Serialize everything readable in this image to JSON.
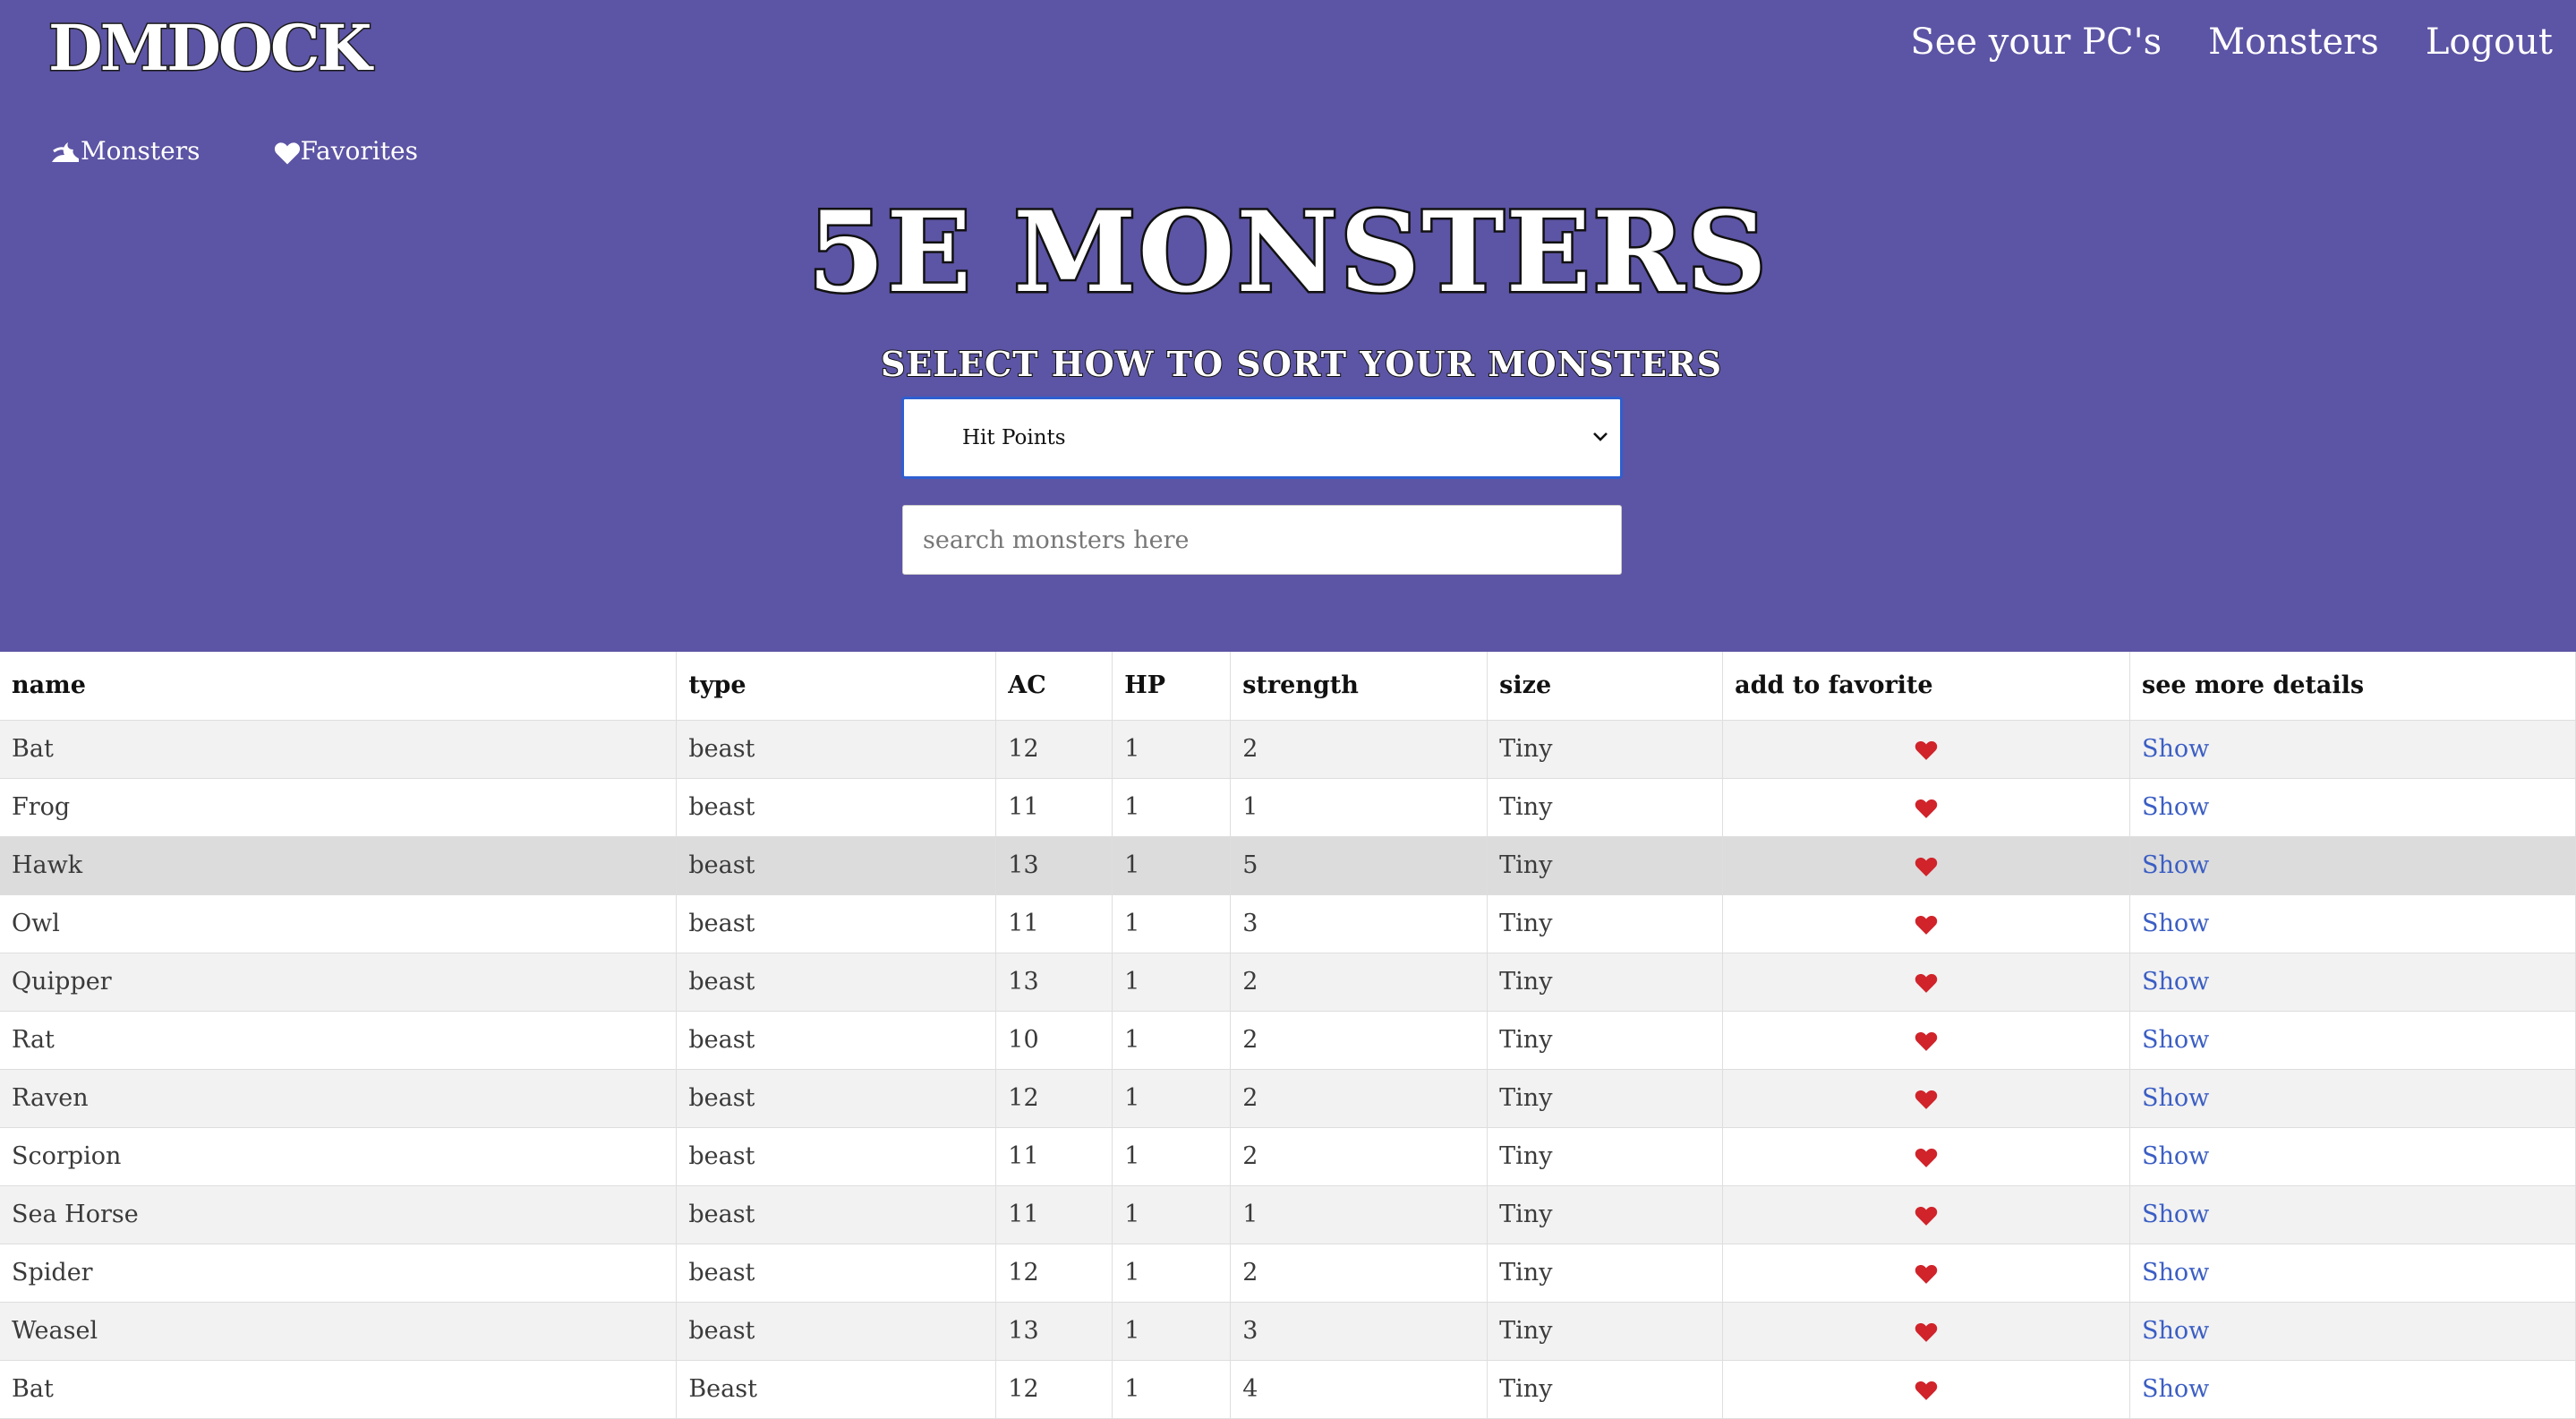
{
  "brand": {
    "logo_text": "DMDOCK"
  },
  "topnav": {
    "items": [
      "See your PC's",
      "Monsters",
      "Logout"
    ]
  },
  "subnav": {
    "monsters_label": "Monsters",
    "favorites_label": "Favorites"
  },
  "page": {
    "title": "5E MONSTERS",
    "sort_label": "SELECT HOW TO SORT YOUR MONSTERS",
    "sort_selected": "Hit Points",
    "search_placeholder": "search monsters here"
  },
  "table": {
    "headers": [
      "name",
      "type",
      "AC",
      "HP",
      "strength",
      "size",
      "add to favorite",
      "see more details"
    ],
    "rows": [
      {
        "name": "Bat",
        "type": "beast",
        "ac": "12",
        "hp": "1",
        "strength": "2",
        "size": "Tiny",
        "details": "Show"
      },
      {
        "name": "Frog",
        "type": "beast",
        "ac": "11",
        "hp": "1",
        "strength": "1",
        "size": "Tiny",
        "details": "Show"
      },
      {
        "name": "Hawk",
        "type": "beast",
        "ac": "13",
        "hp": "1",
        "strength": "5",
        "size": "Tiny",
        "details": "Show"
      },
      {
        "name": "Owl",
        "type": "beast",
        "ac": "11",
        "hp": "1",
        "strength": "3",
        "size": "Tiny",
        "details": "Show"
      },
      {
        "name": "Quipper",
        "type": "beast",
        "ac": "13",
        "hp": "1",
        "strength": "2",
        "size": "Tiny",
        "details": "Show"
      },
      {
        "name": "Rat",
        "type": "beast",
        "ac": "10",
        "hp": "1",
        "strength": "2",
        "size": "Tiny",
        "details": "Show"
      },
      {
        "name": "Raven",
        "type": "beast",
        "ac": "12",
        "hp": "1",
        "strength": "2",
        "size": "Tiny",
        "details": "Show"
      },
      {
        "name": "Scorpion",
        "type": "beast",
        "ac": "11",
        "hp": "1",
        "strength": "2",
        "size": "Tiny",
        "details": "Show"
      },
      {
        "name": "Sea Horse",
        "type": "beast",
        "ac": "11",
        "hp": "1",
        "strength": "1",
        "size": "Tiny",
        "details": "Show"
      },
      {
        "name": "Spider",
        "type": "beast",
        "ac": "12",
        "hp": "1",
        "strength": "2",
        "size": "Tiny",
        "details": "Show"
      },
      {
        "name": "Weasel",
        "type": "beast",
        "ac": "13",
        "hp": "1",
        "strength": "3",
        "size": "Tiny",
        "details": "Show"
      },
      {
        "name": "Bat",
        "type": "Beast",
        "ac": "12",
        "hp": "1",
        "strength": "4",
        "size": "Tiny",
        "details": "Show"
      }
    ]
  },
  "colors": {
    "header_bg": "#5c54a4",
    "heart": "#d0232a",
    "link": "#3b5ec4",
    "select_border": "#2e5fd1"
  },
  "icons": {
    "favorite": "heart-icon",
    "monsters_nav": "monster-icon",
    "favorites_nav": "heart-icon",
    "select": "chevron-down-icon"
  }
}
